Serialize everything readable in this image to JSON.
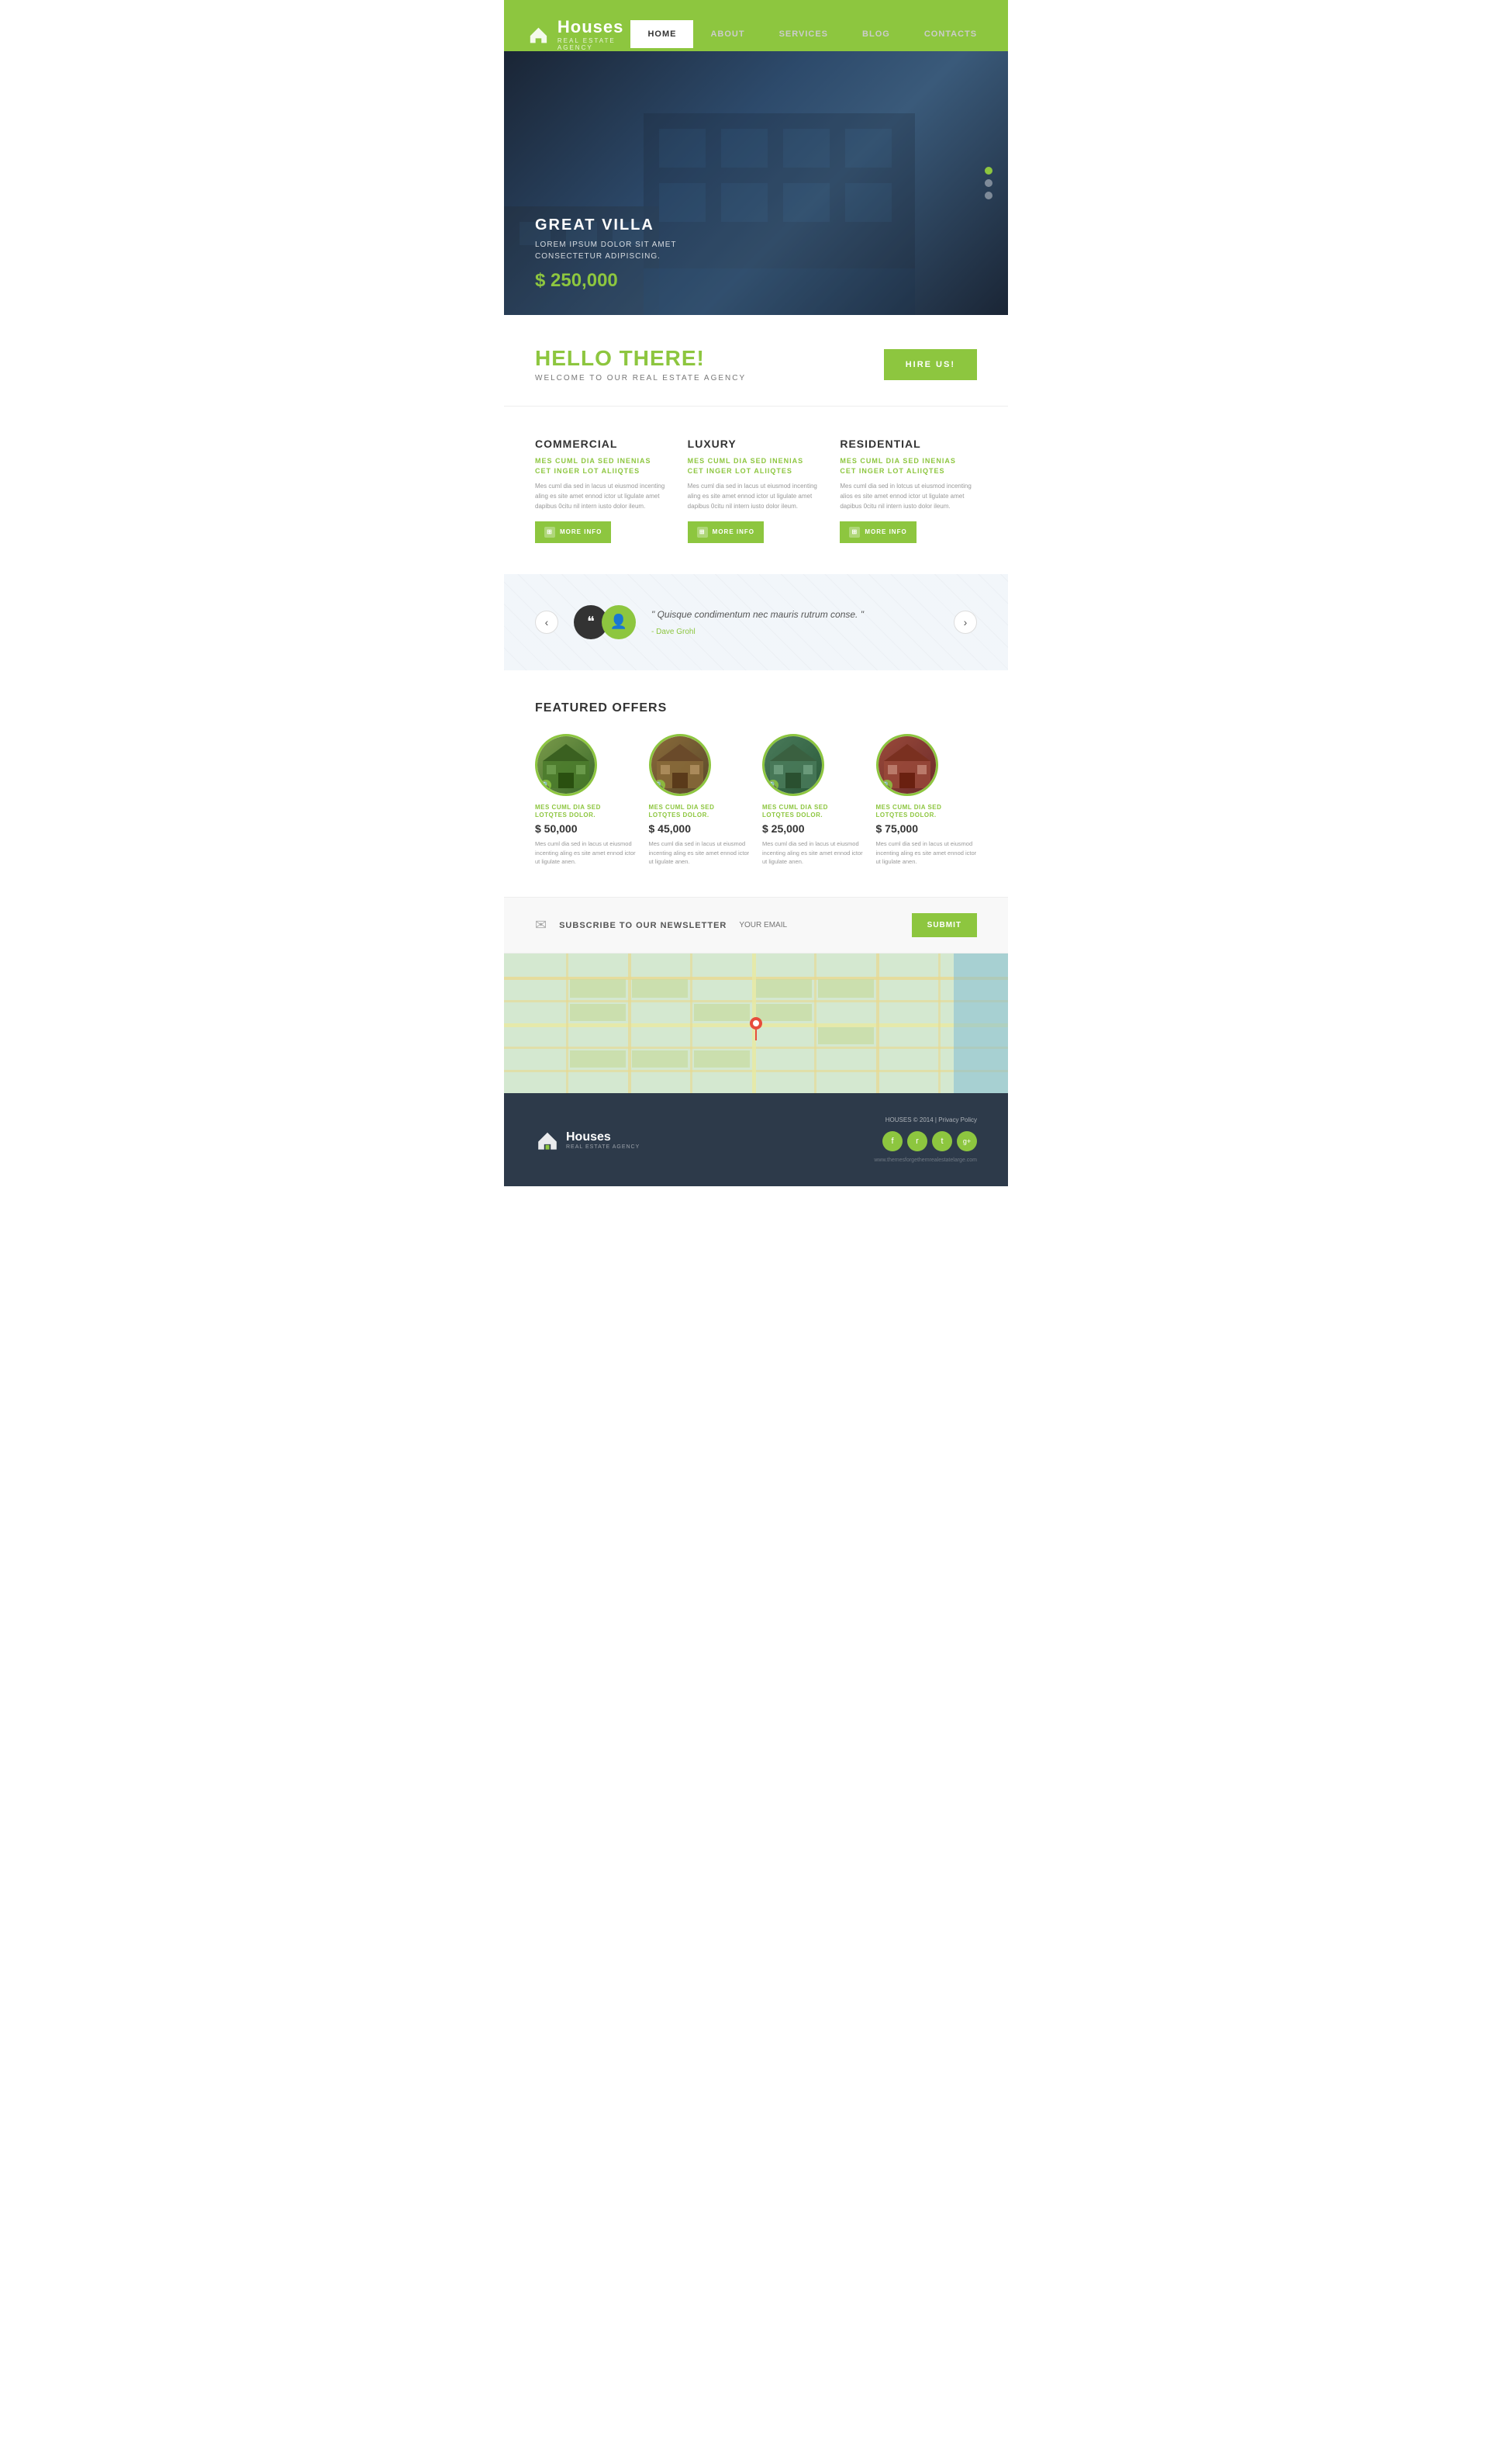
{
  "topbar": {},
  "header": {
    "logo_title": "Houses",
    "logo_sub": "REAL ESTATE AGENCY",
    "nav": [
      {
        "label": "HOME",
        "active": true
      },
      {
        "label": "ABOUT",
        "active": false
      },
      {
        "label": "SERVICES",
        "active": false
      },
      {
        "label": "BLOG",
        "active": false
      },
      {
        "label": "CONTACTS",
        "active": false
      }
    ]
  },
  "hero": {
    "title": "GREAT VILLA",
    "description": "LOREM IPSUM DOLOR SIT AMET\nCONSECTETUR ADIPISCING.",
    "price": "$ 250,000",
    "dots": [
      {
        "active": true
      },
      {
        "active": false
      },
      {
        "active": false
      }
    ]
  },
  "welcome": {
    "title": "HELLO THERE!",
    "subtitle": "WELCOME TO OUR REAL ESTATE AGENCY",
    "hire_label": "HIRE US!"
  },
  "services": [
    {
      "title": "COMMERCIAL",
      "subtitle": "MES CUML DIA SED INENIAS\nCET INGER LOT ALIIQTES",
      "desc": "Mes cuml dia sed in lacus ut eiusmod incenting aling es site amet ennod ictor ut ligulate amet dapibus 0citu nil intern iusto dolor ileum.",
      "more_info": "MORE INFO"
    },
    {
      "title": "LUXURY",
      "subtitle": "MES CUML DIA SED INENIAS\nCET INGER LOT ALIIQTES",
      "desc": "Mes cuml dia sed in lacus ut eiusmod incenting aling es site amet ennod ictor ut ligulate amet dapibus 0citu nil intern iusto dolor ileum.",
      "more_info": "MORE INFO"
    },
    {
      "title": "RESIDENTIAL",
      "subtitle": "MES CUML DIA SED INENIAS\nCET INGER LOT ALIIQTES",
      "desc": "Mes cuml dia sed in lotcus ut eiusmod incenting alios es site amet ennod ictor ut ligulate amet dapibus 0citu nil intern iusto dolor ileum.",
      "more_info": "MORE INFO"
    }
  ],
  "testimonial": {
    "text": "\" Quisque condimentum nec mauris rutrum conse. \"",
    "author": "- Dave Grohl"
  },
  "featured": {
    "title": "FEATURED OFFERS",
    "items": [
      {
        "name": "MES CUML DIA SED\nLOTQTES DOLOR.",
        "price": "$ 50,000",
        "desc": "Mes cuml dia sed in lacus ut eiusmod incenting aling es site amet ennod ictor ut ligulate anen."
      },
      {
        "name": "MES CUML DIA SED\nLOTQTES DOLOR.",
        "price": "$ 45,000",
        "desc": "Mes cuml dia sed in lacus ut eiusmod incenting aling es site amet ennod ictor ut ligulate anen."
      },
      {
        "name": "MES CUML DIA SED\nLOTQTES DOLOR.",
        "price": "$ 25,000",
        "desc": "Mes cuml dia sed in lacus ut eiusmod incenting aling es site amet ennod ictor ut ligulate anen."
      },
      {
        "name": "MES CUML DIA SED\nLOTQTES DOLOR.",
        "price": "$ 75,000",
        "desc": "Mes cuml dia sed in lacus ut eiusmod incenting aling es site amet ennod ictor ut ligulate anen."
      }
    ]
  },
  "newsletter": {
    "icon": "✉",
    "title": "SUBSCRIBE TO OUR NEWSLETTER",
    "placeholder": "YOUR EMAIL",
    "submit_label": "SUBMIT"
  },
  "footer": {
    "logo_title": "Houses",
    "logo_sub": "REAL ESTATE AGENCY",
    "copyright": "HOUSES © 2014 | Privacy Policy",
    "social": [
      "f",
      "r",
      "t",
      "g+"
    ],
    "url": "www.themesforgethemrealestatelarge.com"
  }
}
